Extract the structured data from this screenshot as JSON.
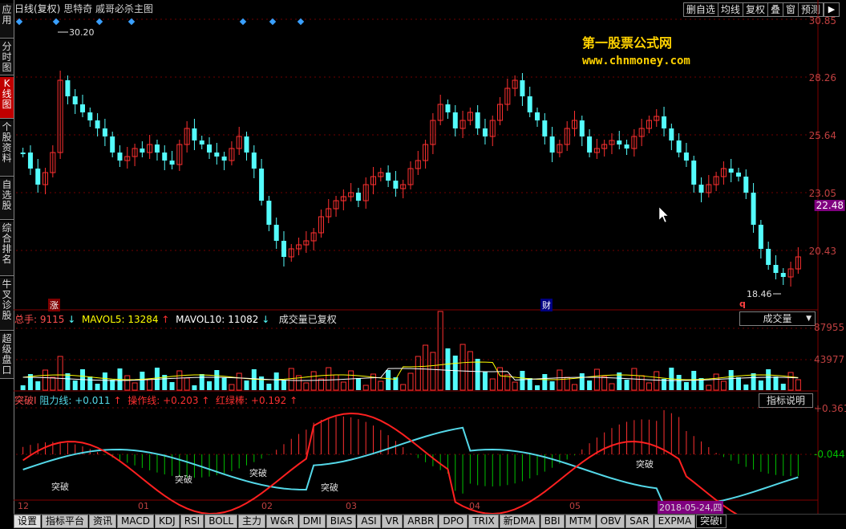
{
  "window": {
    "title_period": "日线(复权)",
    "stock_name": "思特奇",
    "formula_name": "戚哥必杀主图"
  },
  "sidebar": {
    "tabs": [
      {
        "label": "应用",
        "active": false
      },
      {
        "label": "分时图",
        "active": false
      },
      {
        "label": "K线图",
        "active": true
      },
      {
        "label": "个股资料",
        "active": false
      },
      {
        "label": "自选股",
        "active": false
      },
      {
        "label": "综合排名",
        "active": false
      },
      {
        "label": "牛叉诊股",
        "active": false
      },
      {
        "label": "超级盘口",
        "active": false
      }
    ]
  },
  "toolbar": {
    "buttons": [
      "删自选",
      "均线",
      "复权",
      "叠",
      "窗",
      "预测"
    ],
    "menu_arrow": "▶"
  },
  "watermark": {
    "line1": "第一股票公式网",
    "line2": "www.chnmoney.com"
  },
  "price_axis": {
    "labels": [
      "30.85",
      "28.26",
      "25.64",
      "23.05",
      "20.43"
    ],
    "current": "22.48",
    "high_mark": "30.20",
    "low_mark": "18.46"
  },
  "event_marks": {
    "zhang": "涨",
    "cai": "财",
    "q": "q"
  },
  "volume": {
    "label_total": "总手:",
    "total_value": "9115",
    "total_dir": "↓",
    "mavol5_label": "MAVOL5:",
    "mavol5_value": "13284",
    "mavol5_dir": "↑",
    "mavol10_label": "MAVOL10:",
    "mavol10_value": "11082",
    "mavol10_dir": "↓",
    "note": "成交量已复权",
    "selector": "成交量",
    "axis": [
      "87955",
      "43977"
    ]
  },
  "indicator": {
    "name": "突破I",
    "resist_label": "阻力线:",
    "resist_value": "+0.011",
    "resist_dir": "↑",
    "oper_label": "操作线:",
    "oper_value": "+0.203",
    "oper_dir": "↑",
    "red_label": "红绿棒:",
    "red_value": "+0.192",
    "red_dir": "↑",
    "help_button": "指标说明",
    "axis": [
      "+0.361",
      "-0.044"
    ],
    "signal_label": "突破"
  },
  "dates": {
    "labels": [
      "12",
      "01",
      "02",
      "03",
      "04",
      "05"
    ],
    "current": "2018-05-24,四"
  },
  "bottom_tabs": [
    "设置",
    "指标平台",
    "资讯",
    "MACD",
    "KDJ",
    "RSI",
    "BOLL",
    "主力",
    "W&R",
    "DMI",
    "BIAS",
    "ASI",
    "VR",
    "ARBR",
    "DPO",
    "TRIX",
    "新DMA",
    "BBI",
    "MTM",
    "OBV",
    "SAR",
    "EXPMA",
    "突破I"
  ],
  "colors": {
    "up": "#ff3030",
    "down": "#54fcfc",
    "resist_line": "#54d8e8",
    "oper_line": "#ff2020",
    "green_bar": "#00c000",
    "yellow": "#ffff00",
    "axis": "#800000"
  }
}
